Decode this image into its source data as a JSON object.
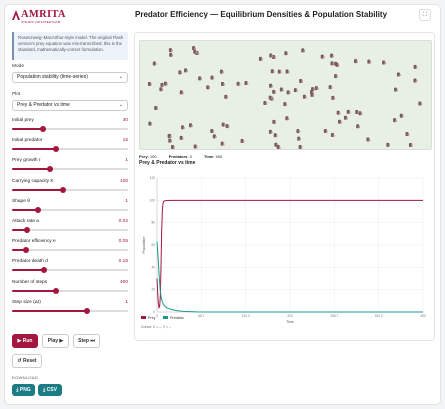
{
  "header": {
    "logo_text": "AMRITA",
    "logo_tagline": "VISHWA VIDYAPEETHAM",
    "title": "Predator Efficiency — Equilibrium Densities & Population Stability",
    "fullscreen_icon": "expand-icon"
  },
  "note": "Rosenzweig–MacArthur-style model. The original Flash version's prey equation was mis-transcribed; this is the standard, mathematically-correct formulation.",
  "controls": {
    "mode_label": "Mode",
    "mode_value": "Population stability (time-series)",
    "plot_label": "Plot",
    "plot_value": "Prey & Predator vs time",
    "params": [
      {
        "label": "Initial prey",
        "value": "30",
        "fraction": 0.27
      },
      {
        "label": "Initial predator",
        "value": "15",
        "fraction": 0.38
      },
      {
        "label": "Prey growth r",
        "value": "1",
        "fraction": 0.33
      },
      {
        "label": "Carrying capacity K",
        "value": "100",
        "fraction": 0.44
      },
      {
        "label": "Shape θ",
        "value": "1",
        "fraction": 0.22
      },
      {
        "label": "Attack rate a",
        "value": "0.02",
        "fraction": 0.13
      },
      {
        "label": "Predator efficiency e",
        "value": "0.05",
        "fraction": 0.12
      },
      {
        "label": "Predator death d",
        "value": "0.15",
        "fraction": 0.28
      },
      {
        "label": "Number of steps",
        "value": "400",
        "fraction": 0.38
      },
      {
        "label": "Step size (Δt)",
        "value": "1",
        "fraction": 0.65
      }
    ],
    "run_label": "▶ Run",
    "play_label": "Play ▶",
    "step_label": "Step ⏭",
    "reset_label": "↺ Reset",
    "download_label": "DOWNLOAD",
    "png_label": "⤓ PNG",
    "csv_label": "⤓ CSV"
  },
  "simulation": {
    "prey_label": "Prey",
    "prey_value": "100",
    "predator_label": "Predators",
    "predator_value": "0",
    "time_label": "Time",
    "time_value": "400"
  },
  "plot_title": "Prey & Predator vs time",
  "cursor_text": "Cursor: X = –, Y = –",
  "colors": {
    "prey": "#a3173f",
    "predator": "#1b9a8a",
    "accent": "#a3173f"
  },
  "chart_data": {
    "type": "line",
    "xlabel": "Time",
    "ylabel": "Population",
    "xlim": [
      0,
      400
    ],
    "ylim": [
      0,
      120
    ],
    "xticks": [
      "0",
      "66.7",
      "133.3",
      "200",
      "266.7",
      "333.3",
      "400"
    ],
    "yticks": [
      "0",
      "20",
      "40",
      "60",
      "80",
      "100",
      "120"
    ],
    "legend": "bottom-left",
    "series": [
      {
        "name": "Prey",
        "color": "#a3173f",
        "x": [
          0,
          1,
          2,
          3,
          4,
          5,
          6,
          7,
          8,
          9,
          10,
          12,
          14,
          16,
          20,
          30,
          50,
          100,
          200,
          300,
          400
        ],
        "y": [
          30,
          18,
          8,
          4,
          5,
          14,
          40,
          72,
          90,
          97,
          99,
          99.6,
          99.8,
          99.9,
          100,
          100,
          100,
          100,
          100,
          100,
          100
        ]
      },
      {
        "name": "Predator",
        "color": "#1b9a8a",
        "x": [
          0,
          1,
          2,
          3,
          4,
          5,
          6,
          8,
          10,
          14,
          18,
          22,
          30,
          40,
          60,
          80,
          100,
          150,
          200,
          300,
          400
        ],
        "y": [
          63,
          55,
          45,
          35,
          26,
          19,
          14,
          9,
          6.5,
          4,
          3,
          2.2,
          1.2,
          0.6,
          0.15,
          0.05,
          0,
          0,
          0,
          0,
          0
        ]
      }
    ]
  }
}
